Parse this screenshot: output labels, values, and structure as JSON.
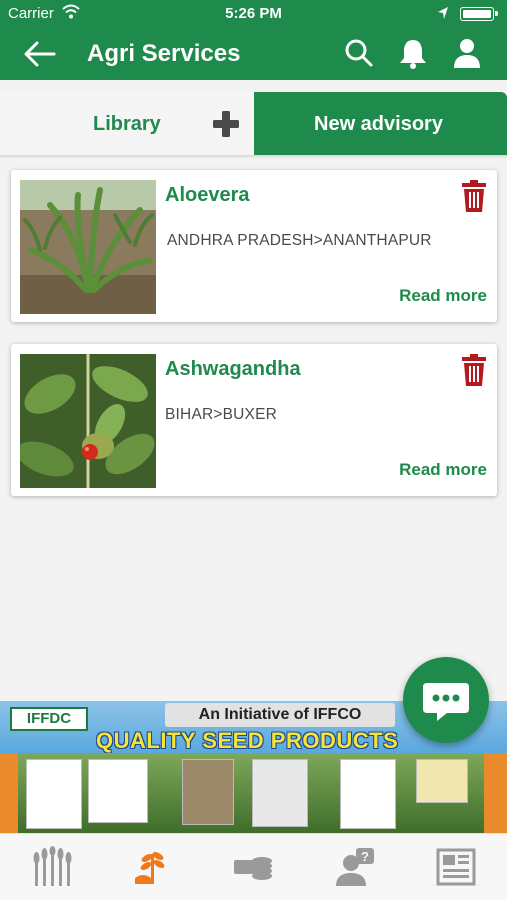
{
  "status_bar": {
    "carrier": "Carrier",
    "time": "5:26 PM"
  },
  "header": {
    "title": "Agri Services"
  },
  "tabs": {
    "library": "Library",
    "new_advisory": "New advisory"
  },
  "advisories": [
    {
      "name": "Aloevera",
      "location": "ANDHRA PRADESH>ANANTHAPUR",
      "action": "Read more"
    },
    {
      "name": "Ashwagandha",
      "location": "BIHAR>BUXER",
      "action": "Read more"
    }
  ],
  "banner": {
    "logo": "IFFDC",
    "initiative": "An Initiative of IFFCO",
    "headline": "QUALITY SEED PRODUCTS"
  },
  "colors": {
    "primary": "#1e8a4c",
    "delete": "#b3191e"
  },
  "icons": [
    "back-arrow-icon",
    "search-icon",
    "bell-icon",
    "profile-icon",
    "plus-icon",
    "trash-icon",
    "chat-icon",
    "crops-icon",
    "agri-services-icon",
    "money-icon",
    "expert-help-icon",
    "news-icon"
  ]
}
